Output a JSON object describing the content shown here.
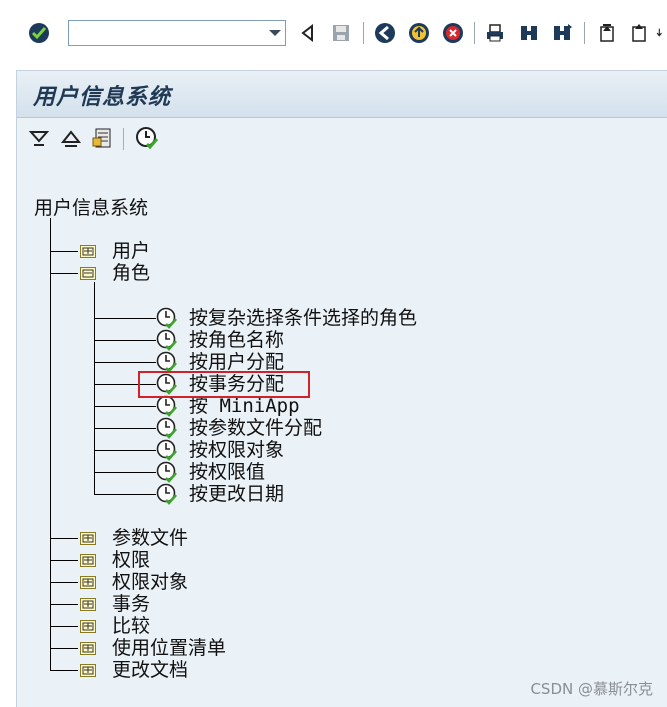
{
  "toolbar": {
    "command_field_value": "",
    "icons": [
      "enter-check-icon",
      "command-field-dropdown",
      "back-triangle-icon",
      "save-icon",
      "back-green-icon",
      "exit-yellow-icon",
      "cancel-red-icon",
      "print-icon",
      "find-icon",
      "find-next-icon",
      "first-page-icon",
      "prev-page-icon"
    ]
  },
  "window": {
    "title": "用户信息系统"
  },
  "app_toolbar": {
    "icons": [
      "expand-all-icon",
      "collapse-all-icon",
      "select-variant-icon",
      "execute-clock-icon"
    ]
  },
  "tree": {
    "root": "用户信息系统",
    "nodes_top": [
      {
        "label": "用户",
        "type": "folder"
      },
      {
        "label": "角色",
        "type": "folder-open"
      }
    ],
    "role_children": [
      {
        "label": "按复杂选择条件选择的角色"
      },
      {
        "label": "按角色名称"
      },
      {
        "label": "按用户分配"
      },
      {
        "label": "按事务分配",
        "highlighted": true
      },
      {
        "label": "按 MiniApp"
      },
      {
        "label": "按参数文件分配"
      },
      {
        "label": "按权限对象"
      },
      {
        "label": "按权限值"
      },
      {
        "label": "按更改日期"
      }
    ],
    "nodes_bottom": [
      {
        "label": "参数文件"
      },
      {
        "label": "权限"
      },
      {
        "label": "权限对象"
      },
      {
        "label": "事务"
      },
      {
        "label": "比较"
      },
      {
        "label": "使用位置清单"
      },
      {
        "label": "更改文档"
      }
    ]
  },
  "watermark": "CSDN @慕斯尔克"
}
